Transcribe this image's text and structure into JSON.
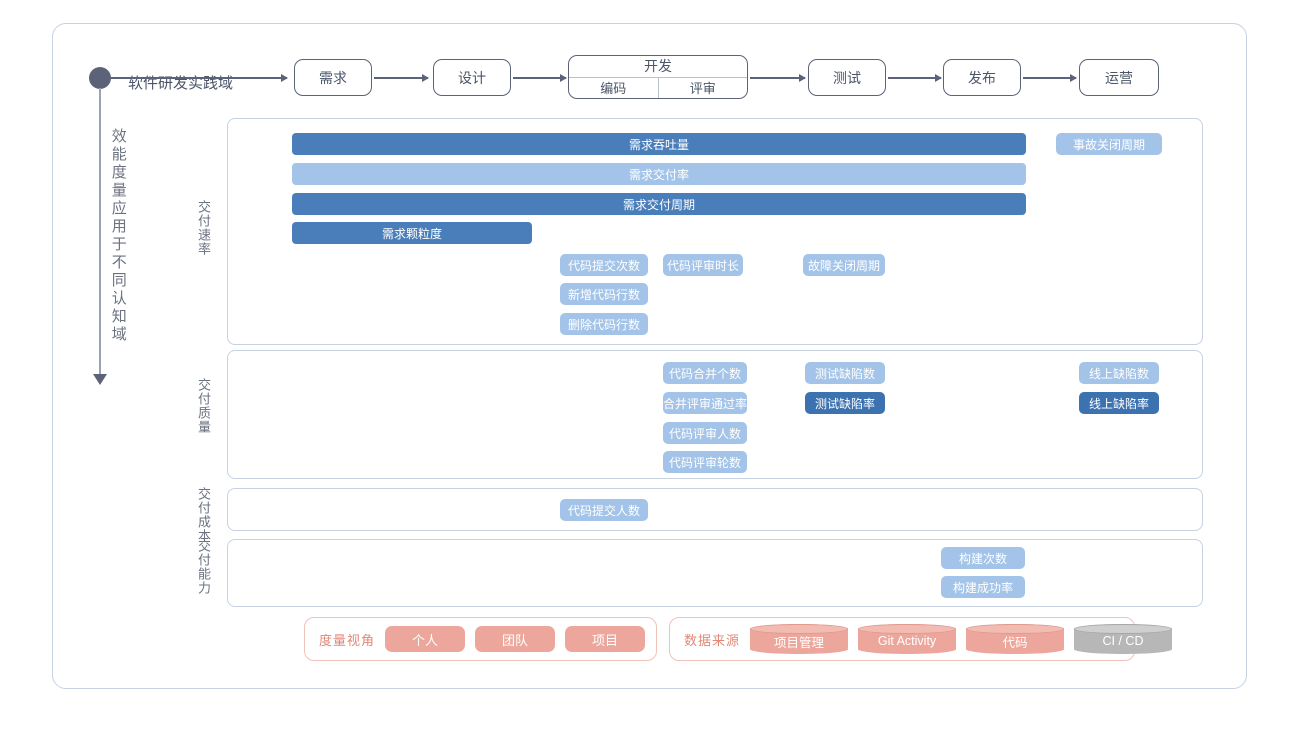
{
  "diagram": {
    "axis": {
      "vertical_label": "效能度量应用于不同认知域",
      "practice_domain_label": "软件研发实践域"
    },
    "flow": {
      "stages": [
        {
          "label": "需求"
        },
        {
          "label": "设计"
        },
        {
          "label": "开发",
          "sub": [
            "编码",
            "评审"
          ]
        },
        {
          "label": "测试"
        },
        {
          "label": "发布"
        },
        {
          "label": "运营"
        }
      ]
    },
    "panels": [
      {
        "label": "交付速率",
        "bars": [
          {
            "text": "需求吞吐量",
            "tone": "dark"
          },
          {
            "text": "需求交付率",
            "tone": "light"
          },
          {
            "text": "需求交付周期",
            "tone": "dark"
          },
          {
            "text": "需求颗粒度",
            "tone": "dark"
          }
        ],
        "pills": [
          {
            "text": "事故关闭周期",
            "tone": "light"
          },
          {
            "text": "代码提交次数",
            "tone": "light"
          },
          {
            "text": "代码评审时长",
            "tone": "light"
          },
          {
            "text": "故障关闭周期",
            "tone": "light"
          },
          {
            "text": "新增代码行数",
            "tone": "light"
          },
          {
            "text": "删除代码行数",
            "tone": "light"
          }
        ]
      },
      {
        "label": "交付质量",
        "pills": [
          {
            "text": "代码合并个数",
            "tone": "light"
          },
          {
            "text": "测试缺陷数",
            "tone": "light"
          },
          {
            "text": "线上缺陷数",
            "tone": "light"
          },
          {
            "text": "合并评审通过率",
            "tone": "light"
          },
          {
            "text": "测试缺陷率",
            "tone": "dark"
          },
          {
            "text": "线上缺陷率",
            "tone": "dark"
          },
          {
            "text": "代码评审人数",
            "tone": "light"
          },
          {
            "text": "代码评审轮数",
            "tone": "light"
          }
        ]
      },
      {
        "label": "交付成本",
        "pills": [
          {
            "text": "代码提交人数",
            "tone": "light"
          }
        ]
      },
      {
        "label": "交付能力",
        "pills": [
          {
            "text": "构建次数",
            "tone": "light"
          },
          {
            "text": "构建成功率",
            "tone": "light"
          }
        ]
      }
    ],
    "legend": {
      "perspective": {
        "title": "度量视角",
        "chips": [
          "个人",
          "团队",
          "项目"
        ]
      },
      "sources": {
        "title": "数据来源",
        "items": [
          {
            "label": "项目管理",
            "tone": "salmon"
          },
          {
            "label": "Git Activity",
            "tone": "salmon"
          },
          {
            "label": "代码",
            "tone": "salmon"
          },
          {
            "label": "CI / CD",
            "tone": "gray"
          }
        ]
      }
    },
    "colors": {
      "bar_dark": "#4a7ebb",
      "bar_light": "#a3c4e8",
      "pill_dark": "#3d72b0",
      "pill_light": "#a3c4e8",
      "salmon": "#eda69b",
      "gray": "#b7b7b7",
      "border": "#c6d2e2",
      "flow_stroke": "#5c6378"
    }
  }
}
